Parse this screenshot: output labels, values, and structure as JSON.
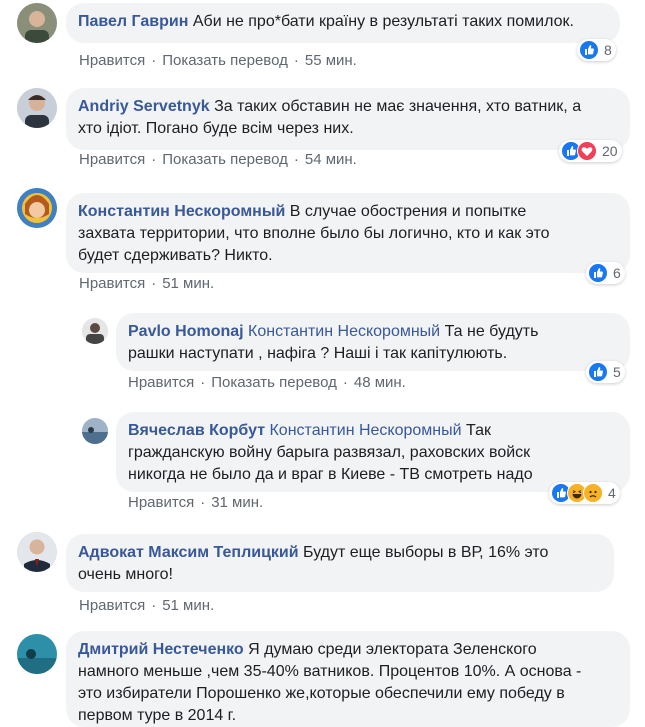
{
  "comments": [
    {
      "author": "Павел Гаврин",
      "text": "Аби не про*бати країну в результаті таких помилок.",
      "actions": [
        "Нравится",
        "Показать перевод",
        "55 мин."
      ],
      "reactions": {
        "icons": [
          "like-icon"
        ],
        "count": "8"
      }
    },
    {
      "author": "Andriy Servetnyk",
      "text_lines": [
        "За таких обставин не має значення, хто ватник, а",
        "хто ідіот. Погано буде всім через них."
      ],
      "actions": [
        "Нравится",
        "Показать перевод",
        "54 мин."
      ],
      "reactions": {
        "icons": [
          "like-icon",
          "love-icon"
        ],
        "count": "20"
      }
    },
    {
      "author": "Константин Нескоромный",
      "text_lines": [
        "В случае обострения и попытке",
        "захвата территории, что вполне было бы логично, кто и как это",
        "будет сдерживать? Никто."
      ],
      "actions": [
        "Нравится",
        "51 мин."
      ],
      "reactions": {
        "icons": [
          "like-icon"
        ],
        "count": "6"
      }
    },
    {
      "author": "Pavlo Homonaj",
      "mention": "Константин Нескоромный",
      "text_lines": [
        "Та не будуть",
        "рашки наступати , нафіга ? Наші і так капітулюють."
      ],
      "actions": [
        "Нравится",
        "Показать перевод",
        "48 мин."
      ],
      "reactions": {
        "icons": [
          "like-icon"
        ],
        "count": "5"
      }
    },
    {
      "author": "Вячеслав Корбут",
      "mention": "Константин Нескоромный",
      "text_lines": [
        "Так",
        "гражданскую войну барыга развязал, раховских войск",
        "никогда не было да и враг в Киеве - ТВ смотреть надо"
      ],
      "actions": [
        "Нравится",
        "31 мин."
      ],
      "reactions": {
        "icons": [
          "like-icon",
          "haha-icon",
          "sad-icon"
        ],
        "count": "4"
      }
    },
    {
      "author": "Адвокат Максим Теплицкий",
      "text_lines": [
        "Будут еще выборы в ВР, 16% это",
        "очень много!"
      ],
      "actions": [
        "Нравится",
        "51 мин."
      ]
    },
    {
      "author": "Дмитрий Нестеченко",
      "text_lines": [
        "Я думаю среди электората Зеленского",
        "намного меньше ,чем 35-40% ватников. Процентов 10%. А основа -",
        "это избиратели Порошенко же,которые обеспечили ему победу в",
        "первом туре в 2014 г."
      ]
    }
  ],
  "colors": {
    "link": "#385898",
    "bubble": "#f2f3f5",
    "meta": "#606770",
    "like": "#1877f2",
    "love": "#f33e58",
    "haha": "#f7b125"
  }
}
